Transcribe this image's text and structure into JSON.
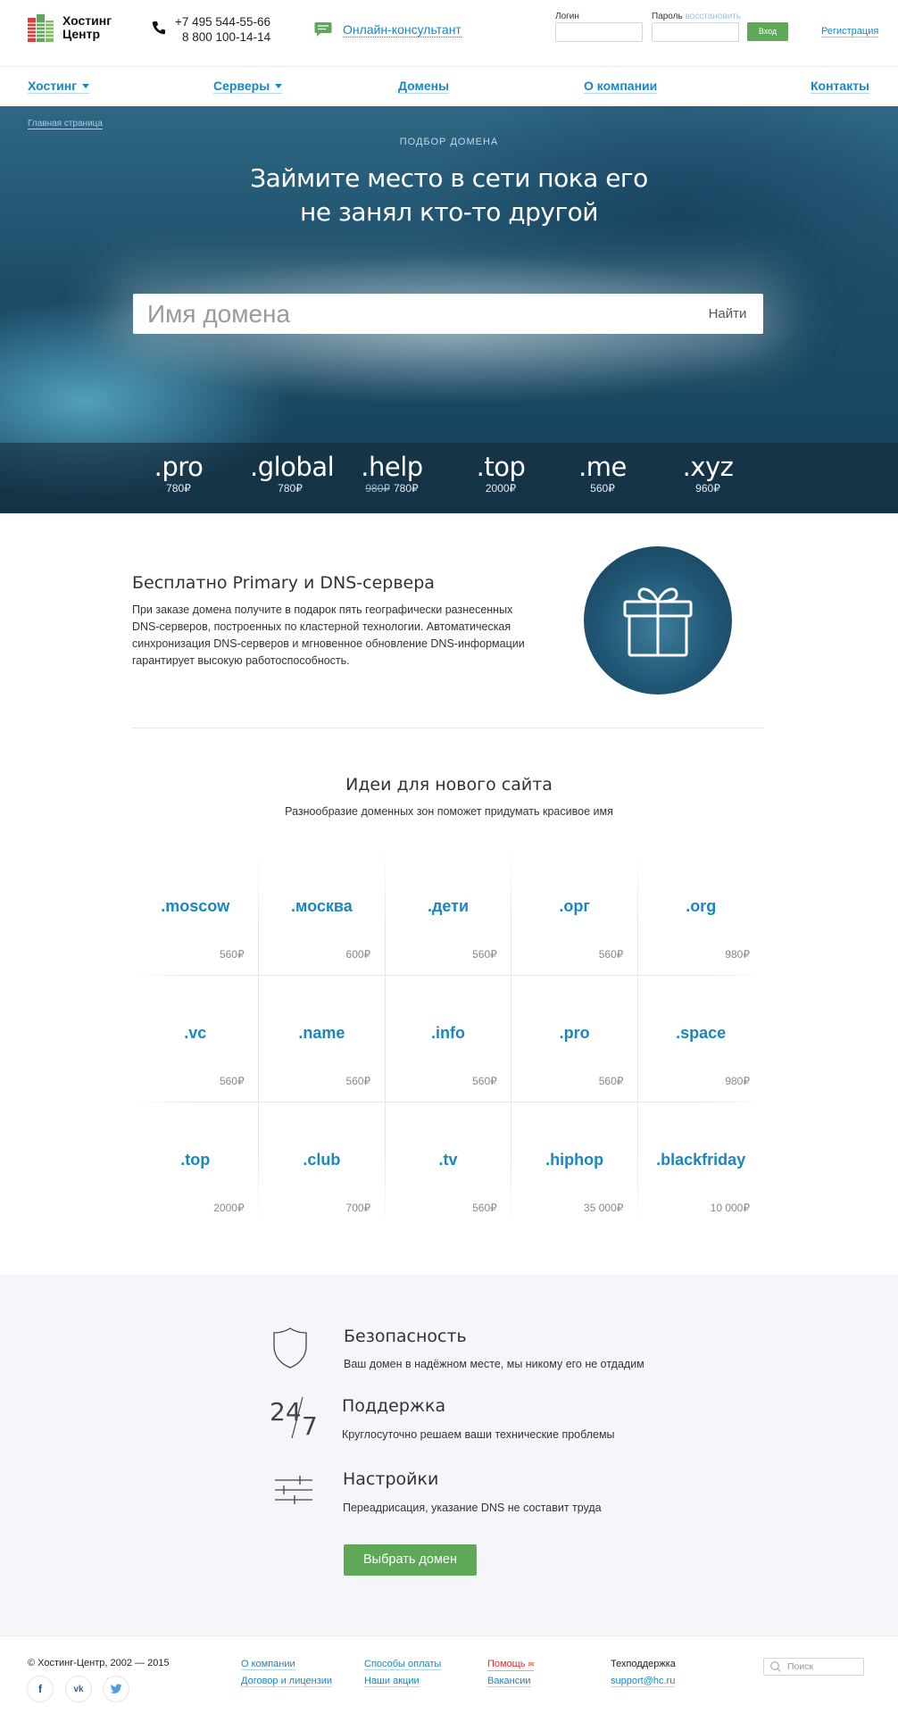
{
  "header": {
    "logo_line1": "Хостинг",
    "logo_line2": "Центр",
    "phone1": "+7 495 544-55-66",
    "phone2": "8 800 100-14-14",
    "chat_label": "Онлайн-консультант",
    "login_label": "Логин",
    "password_label": "Пароль",
    "restore_label": "восстановить",
    "enter_button": "Вход",
    "register_link": "Регистрация"
  },
  "nav": [
    {
      "label": "Хостинг",
      "dropdown": true
    },
    {
      "label": "Серверы",
      "dropdown": true
    },
    {
      "label": "Домены",
      "dropdown": false
    },
    {
      "label": "О компании",
      "dropdown": false
    },
    {
      "label": "Контакты",
      "dropdown": false
    }
  ],
  "hero": {
    "breadcrumb": "Главная страница",
    "eyebrow": "ПОДБОР ДОМЕНА",
    "title_line1": "Займите место в сети пока его",
    "title_line2": "не занял кто-то другой",
    "search_placeholder": "Имя домена",
    "search_button": "Найти",
    "zones": [
      {
        "name": ".pro",
        "price": "780₽",
        "old_price": ""
      },
      {
        "name": ".global",
        "price": "780₽",
        "old_price": ""
      },
      {
        "name": ".help",
        "price": "780₽",
        "old_price": "980₽"
      },
      {
        "name": ".top",
        "price": "2000₽",
        "old_price": ""
      },
      {
        "name": ".me",
        "price": "560₽",
        "old_price": ""
      },
      {
        "name": ".xyz",
        "price": "960₽",
        "old_price": ""
      }
    ]
  },
  "feature": {
    "title": "Бесплатно Primary и DNS-сервера",
    "text": "При заказе домена получите в подарок пять географически разнесенных DNS-серверов, построенных по кластерной технологии. Автоматическая синхронизация DNS-серверов и мгновенное обновление DNS-информации гарантирует высокую работоспособность."
  },
  "ideas": {
    "title": "Идеи для нового сайта",
    "subtitle": "Разнообразие доменных зон поможет придумать красивое имя",
    "domains": [
      {
        "name": ".moscow",
        "price": "560₽"
      },
      {
        "name": ".москва",
        "price": "600₽"
      },
      {
        "name": ".дети",
        "price": "560₽"
      },
      {
        "name": ".орг",
        "price": "560₽"
      },
      {
        "name": ".org",
        "price": "980₽"
      },
      {
        "name": ".vc",
        "price": "560₽"
      },
      {
        "name": ".name",
        "price": "560₽"
      },
      {
        "name": ".info",
        "price": "560₽"
      },
      {
        "name": ".pro",
        "price": "560₽"
      },
      {
        "name": ".space",
        "price": "980₽"
      },
      {
        "name": ".top",
        "price": "2000₽"
      },
      {
        "name": ".club",
        "price": "700₽"
      },
      {
        "name": ".tv",
        "price": "560₽"
      },
      {
        "name": ".hiphop",
        "price": "35 000₽"
      },
      {
        "name": ".blackfriday",
        "price": "10 000₽"
      }
    ]
  },
  "benefits": {
    "items": [
      {
        "title": "Безопасность",
        "text": "Ваш домен в надёжном месте, мы никому его не отдадим",
        "icon": "shield-icon"
      },
      {
        "title": "Поддержка",
        "text": "Круглосуточно решаем ваши технические проблемы",
        "icon": "24-7-icon"
      },
      {
        "title": "Настройки",
        "text": "Переадрисация, указание DNS не составит труда",
        "icon": "sliders-icon"
      }
    ],
    "support_icon_text_24": "24",
    "support_icon_text_7": "7",
    "cta_button": "Выбрать домен"
  },
  "footer": {
    "copyright": "© Хостинг-Центр, 2002 — 2015",
    "links": {
      "about": "О компании",
      "contracts": "Договор и лицензии",
      "payment": "Способы оплаты",
      "promo": "Наши акции",
      "help": "Помощь",
      "jobs": "Вакансии"
    },
    "support_label": "Техподдержка",
    "support_email": "support@hc.ru",
    "search_placeholder": "Поиск",
    "social": [
      "f",
      "vk"
    ]
  },
  "colors": {
    "accent": "#1a86c2",
    "green": "#5ea858",
    "hero_dark": "#16405a"
  }
}
